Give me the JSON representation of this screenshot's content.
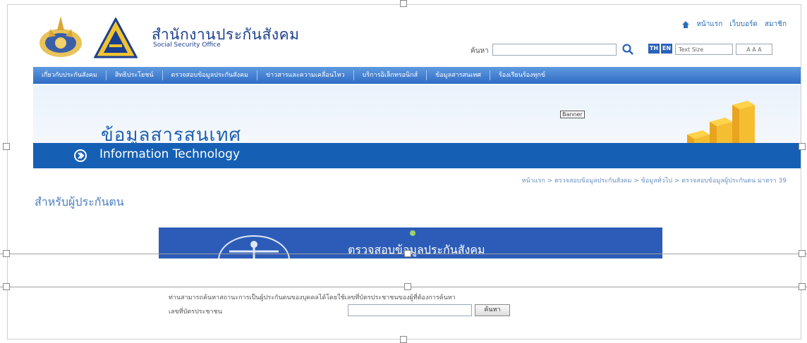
{
  "org": {
    "name_th": "สำนักงานประกันสังคม",
    "name_en": "Social Security Office"
  },
  "toplinks": [
    "หน้าแรก",
    "เว็บบอร์ด",
    "สมาชิก"
  ],
  "search": {
    "label": "ค้นหา"
  },
  "lang": {
    "th": "TH",
    "en": "EN"
  },
  "text_size": {
    "label": "Text Size",
    "controls": "A A A"
  },
  "nav": [
    "เกี่ยวกับประกันสังคม",
    "สิทธิประโยชน์",
    "ตรวจสอบข้อมูลประกันสังคม",
    "ข่าวสารและความเคลื่อนไหว",
    "บริการอิเล็กทรอนิกส์",
    "ข้อมูลสารสนเทศ",
    "ร้องเรียนร้องทุกข์"
  ],
  "banner": {
    "tag": "Banner",
    "title_th": "ข้อมูลสารสนเทศ",
    "subtitle_en": "Information Technology"
  },
  "breadcrumb": "หน้าแรก > ตรวจสอบข้อมูลประกันสังคม > ข้อมูลทั่วไป > ตรวจสอบข้อมูลผู้ประกันตน มาตรา 39",
  "section_title": "สำหรับผู้ประกันตน",
  "promo": {
    "text": "ตรวจสอบข้อมูลประกันสังคม"
  },
  "form": {
    "instructions": "ท่านสามารถค้นหาสถานะการเป็นผู้ประกันตนของบุคคลได้โดยใช้เลขที่บัตรประชาชนของผู้ที่ต้องการค้นหา",
    "id_label": "เลขที่บัตรประชาชน",
    "submit_label": "ค้นหา"
  },
  "colors": {
    "nav_blue": "#2f6cc5",
    "strip_blue": "#1560b4",
    "promo_blue": "#2c5cb8",
    "title_blue": "#1f5fb0"
  }
}
